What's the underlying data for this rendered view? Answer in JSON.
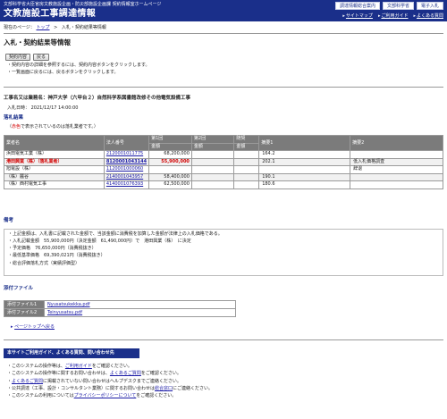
{
  "header": {
    "subtitle": "文部科学省大臣官房文教施設企画・防災部施設企画課 契約情報室ホームページ",
    "title": "文教施設工事調達情報",
    "buttons": [
      "調達情報総合案内",
      "文部科学省",
      "電子入札"
    ],
    "links": [
      "サイトマップ",
      "ご利用ガイド",
      "よくある質問"
    ]
  },
  "breadcrumb": {
    "label": "現在のページ：",
    "items": [
      "トップ",
      "入札・契約結果等情報"
    ]
  },
  "page_title": "入札・契約結果等情報",
  "buttons": {
    "contract_info": "契約内容",
    "back": "戻る"
  },
  "notes": [
    "契約内容の詳細を参照するには、契約内容ボタンをクリックします。",
    "一覧画面に戻るには、戻るボタンをクリックします。"
  ],
  "contract": {
    "name": "工事名又は業務名：神戸大学（六甲台２）自然科学系図書館改修その他電気設備工事",
    "date_label": "入札日時：",
    "date_value": "2021/12/17 14:00:00"
  },
  "bid_result": {
    "heading": "落札結果",
    "legend_prefix": "（",
    "legend_red": "赤色",
    "legend_suffix": "で表示されているのは落札業者です。）",
    "headers": [
      "業者名",
      "法人番号",
      "第1回",
      "第2回",
      "随契",
      "摘要1",
      "摘要2"
    ],
    "subheader_amount": "金額",
    "rows": [
      {
        "name": "浜田電気工業（株）",
        "corp_no": "2120001011775",
        "r1": "68,200,000",
        "r2": "",
        "zuikei": "",
        "note1": "164.2",
        "note2": "",
        "winner": false
      },
      {
        "name": "港田興業（株）（落札業者）",
        "corp_no": "8120001043144",
        "r1": "55,900,000",
        "r2": "",
        "zuikei": "",
        "note1": "202.1",
        "note2": "低入札価格調査",
        "winner": true
      },
      {
        "name": "旭電設（株）",
        "corp_no": "1120001000060",
        "r1": "",
        "r2": "",
        "zuikei": "",
        "note1": "",
        "note2": "辞退",
        "winner": false
      },
      {
        "name": "（株）麓谷",
        "corp_no": "2140001043957",
        "r1": "58,400,000",
        "r2": "",
        "zuikei": "",
        "note1": "190.1",
        "note2": "",
        "winner": false
      },
      {
        "name": "（株）西村電気工事",
        "corp_no": "4140001076393",
        "r1": "62,500,000",
        "r2": "",
        "zuikei": "",
        "note1": "180.6",
        "note2": "",
        "winner": false
      }
    ]
  },
  "remarks": {
    "heading": "備考",
    "lines": [
      "・上記金額は、入札書に記載された金額で、当該金額に消費税を加算した金額が法律上の入札価格である。",
      "・入札記載金額　55,900,000円（決定金額　61,490,000円）で　港田興業（株）　に決定",
      "・予定価格　76,650,000円（消費税抜き）",
      "・最低基準価格　69,390,021円（消費税抜き）",
      "・総合評価落札方式（実績評価型）"
    ]
  },
  "attachments": {
    "heading": "添付ファイル",
    "items": [
      {
        "label": "添付ファイル1",
        "file": "Nyusatsukekka.pdf"
      },
      {
        "label": "添付ファイル2",
        "file": "Teinyusatsu.pdf"
      }
    ]
  },
  "page_top": "ページトップへ戻る",
  "info": {
    "bar": "本サイトご利用ガイド、よくある質問、問い合わせ先",
    "lines": [
      {
        "pre": "このシステムの操作等は、",
        "link": "ご利用ガイド",
        "post": "をご確認ください。"
      },
      {
        "pre": "このシステムの操作等に関するお問い合わせは、",
        "link": "よくあるご質問",
        "post": "をご確認ください。"
      },
      {
        "pre": "",
        "link": "よくあるご質問",
        "post": "に掲載されていない問い合わせはヘルプデスクまでご連絡ください。"
      },
      {
        "pre": "公共調達（工事、設計・コンサルタント業務）に関するお問い合わせは",
        "link": "総合窓口",
        "post": "にご連絡ください。"
      },
      {
        "pre": "このシステムの利用については",
        "link": "プライバシーポリシーについて",
        "post": "をご確認ください。"
      }
    ]
  }
}
